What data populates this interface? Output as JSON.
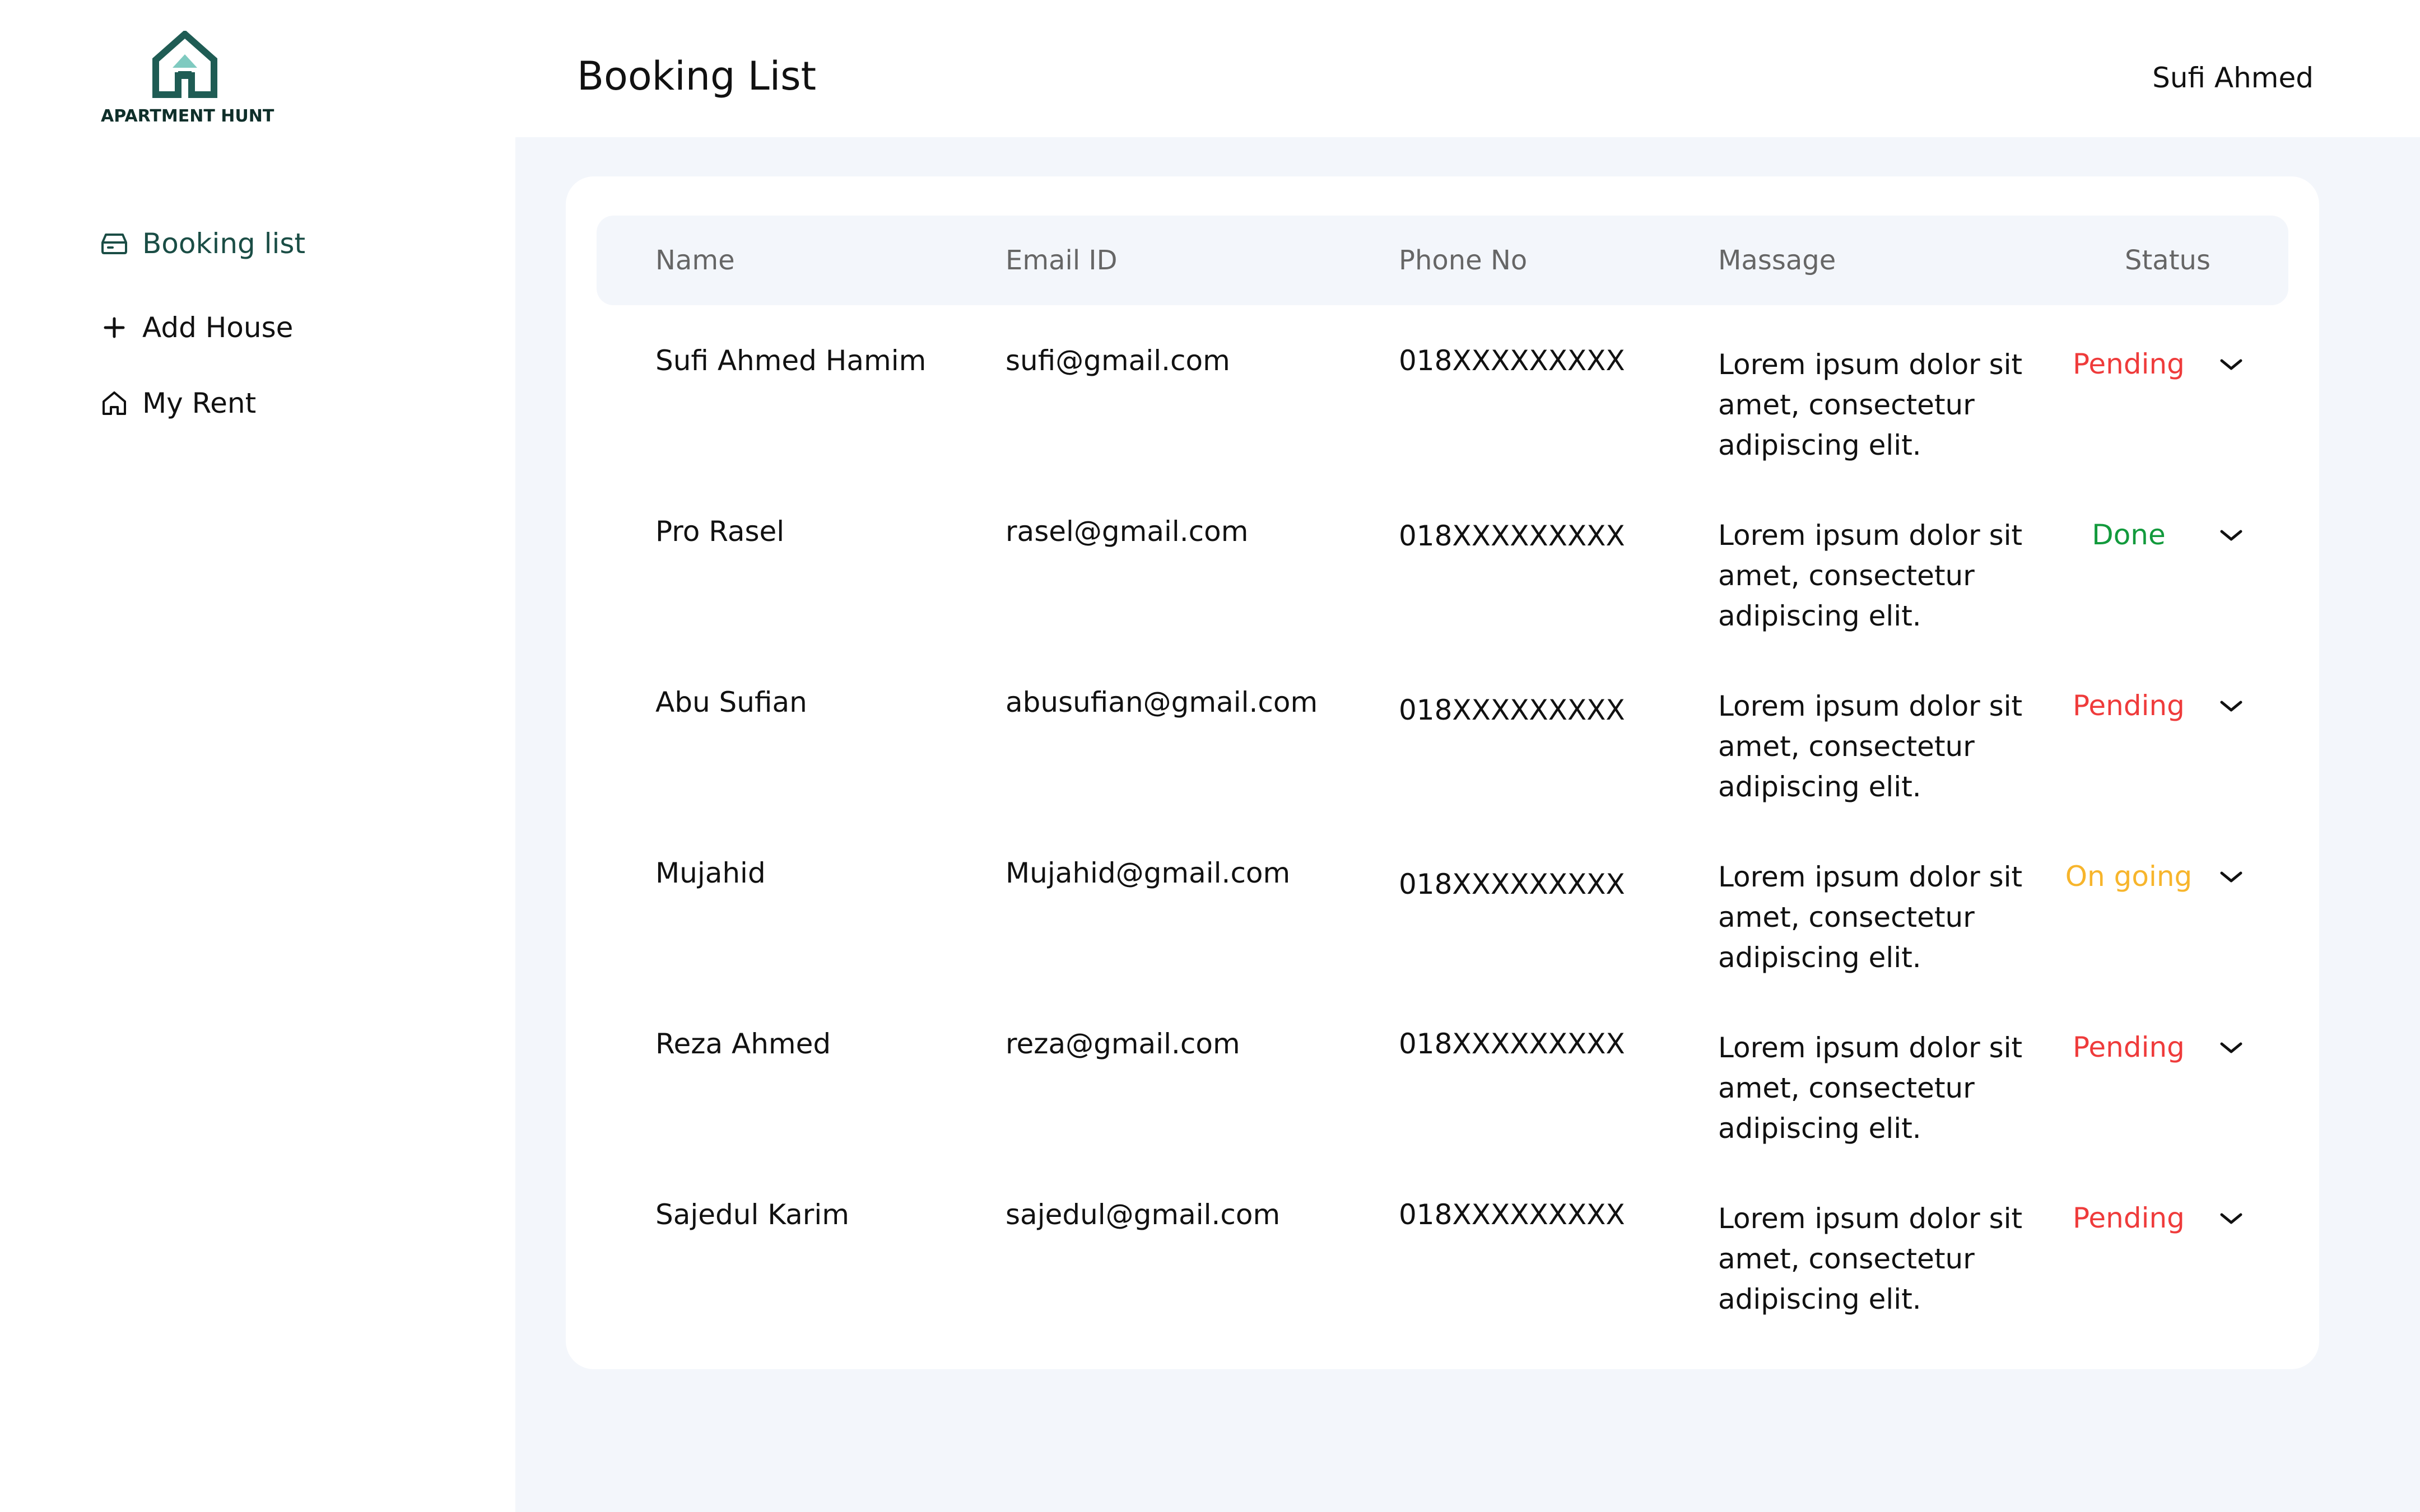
{
  "app": {
    "logo_text": "APARTMENT HUNT",
    "logo_icon": "house-icon",
    "brand_color": "#1f5c54",
    "logo_accent": "#7fcac0"
  },
  "sidebar": {
    "items": [
      {
        "label": "Booking list",
        "icon": "inbox-icon",
        "active": true
      },
      {
        "label": "Add House",
        "icon": "plus-icon",
        "active": false
      },
      {
        "label": "My Rent",
        "icon": "home-icon",
        "active": false
      }
    ]
  },
  "header": {
    "title": "Booking List",
    "user_name": "Sufi Ahmed"
  },
  "table": {
    "columns": [
      "Name",
      "Email ID",
      "Phone No",
      "Massage",
      "Status"
    ],
    "rows": [
      {
        "name": "Sufi Ahmed Hamim",
        "email": "sufi@gmail.com",
        "phone": "018XXXXXXXXX",
        "message": [
          "Lorem ipsum dolor sit",
          "amet, consectetur",
          "adipiscing elit."
        ],
        "status": "Pending"
      },
      {
        "name": "Pro Rasel",
        "email": "rasel@gmail.com",
        "phone": "018XXXXXXXXX",
        "message": [
          "Lorem ipsum dolor sit",
          "amet, consectetur",
          "adipiscing elit."
        ],
        "status": "Done"
      },
      {
        "name": "Abu Sufian",
        "email": "abusufian@gmail.com",
        "phone": "018XXXXXXXXX",
        "message": [
          "Lorem ipsum dolor sit",
          "amet, consectetur",
          "adipiscing elit."
        ],
        "status": "Pending"
      },
      {
        "name": "Mujahid",
        "email": "Mujahid@gmail.com",
        "phone": "018XXXXXXXXX",
        "message": [
          "Lorem ipsum dolor sit",
          "amet, consectetur",
          "adipiscing elit."
        ],
        "status": "On going"
      },
      {
        "name": "Reza Ahmed",
        "email": "reza@gmail.com",
        "phone": "018XXXXXXXXX",
        "message": [
          "Lorem ipsum dolor sit",
          "amet, consectetur",
          "adipiscing elit."
        ],
        "status": "Pending"
      },
      {
        "name": "Sajedul Karim",
        "email": "sajedul@gmail.com",
        "phone": "018XXXXXXXXX",
        "message": [
          "Lorem ipsum dolor sit",
          "amet, consectetur",
          "adipiscing elit."
        ],
        "status": "Pending"
      }
    ]
  },
  "status_colors": {
    "Pending": "#ef3b3b",
    "Done": "#129a3c",
    "On going": "#f7b52c"
  },
  "icons": {
    "status_dropdown": "chevron-down-icon"
  }
}
